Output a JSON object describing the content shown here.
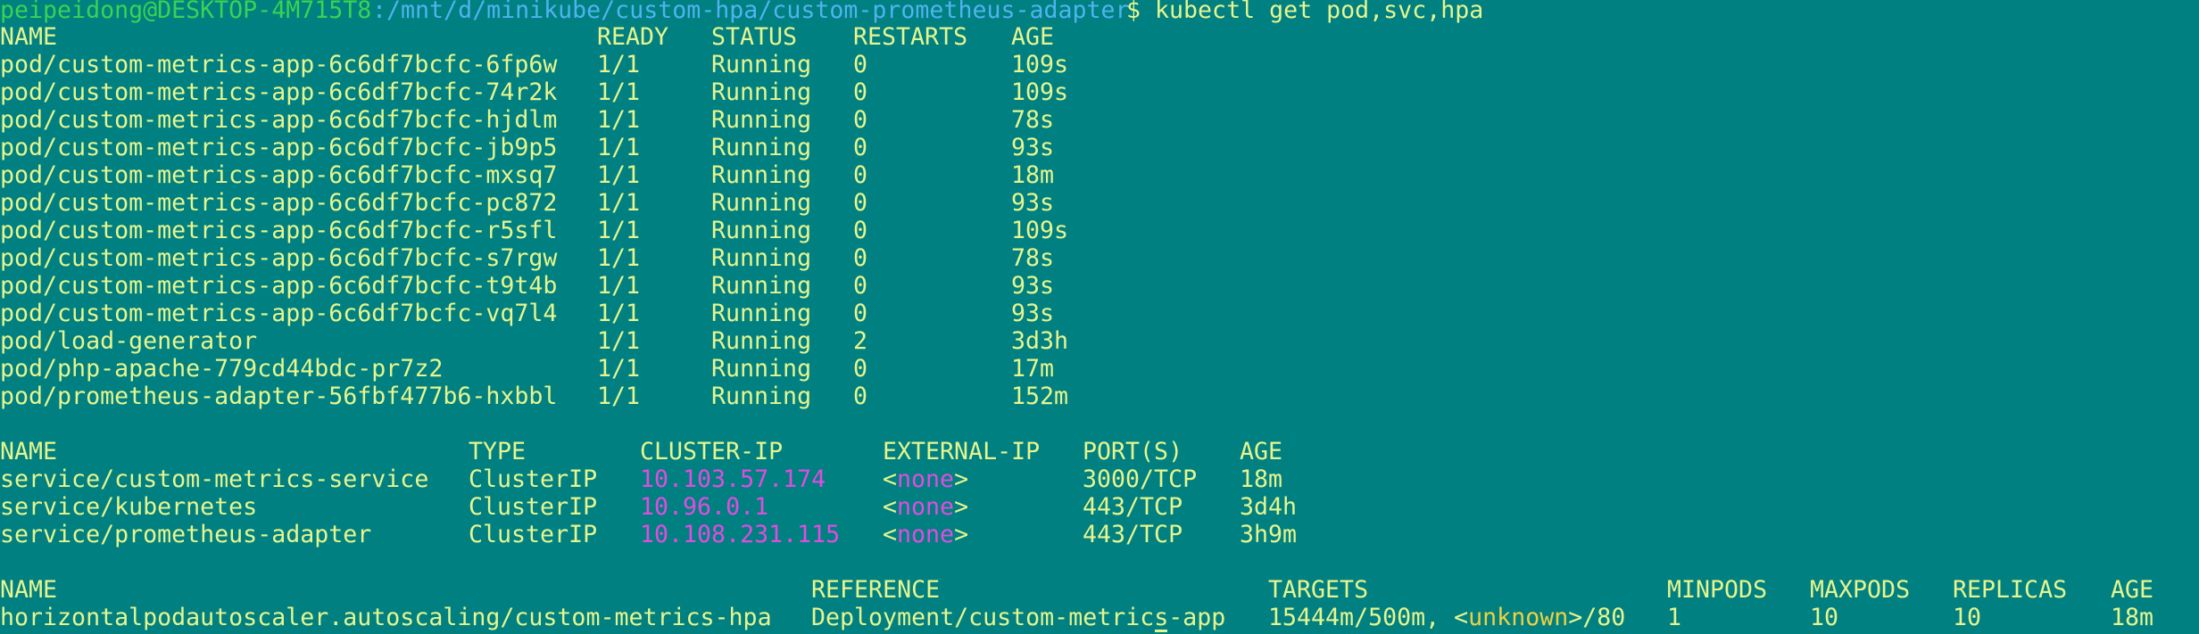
{
  "terminal": {
    "prompt": {
      "user_host": "peipeidong@DESKTOP-4M715T8",
      "path": ":/mnt/d/minikube/custom-hpa/custom-prometheus-adapter",
      "symbol": "$",
      "command": " kubectl get pod,svc,hpa"
    },
    "pods": {
      "headers": [
        "NAME",
        "READY",
        "STATUS",
        "RESTARTS",
        "AGE"
      ],
      "rows": [
        [
          "pod/custom-metrics-app-6c6df7bcfc-6fp6w",
          "1/1",
          "Running",
          "0",
          "109s"
        ],
        [
          "pod/custom-metrics-app-6c6df7bcfc-74r2k",
          "1/1",
          "Running",
          "0",
          "109s"
        ],
        [
          "pod/custom-metrics-app-6c6df7bcfc-hjdlm",
          "1/1",
          "Running",
          "0",
          "78s"
        ],
        [
          "pod/custom-metrics-app-6c6df7bcfc-jb9p5",
          "1/1",
          "Running",
          "0",
          "93s"
        ],
        [
          "pod/custom-metrics-app-6c6df7bcfc-mxsq7",
          "1/1",
          "Running",
          "0",
          "18m"
        ],
        [
          "pod/custom-metrics-app-6c6df7bcfc-pc872",
          "1/1",
          "Running",
          "0",
          "93s"
        ],
        [
          "pod/custom-metrics-app-6c6df7bcfc-r5sfl",
          "1/1",
          "Running",
          "0",
          "109s"
        ],
        [
          "pod/custom-metrics-app-6c6df7bcfc-s7rgw",
          "1/1",
          "Running",
          "0",
          "78s"
        ],
        [
          "pod/custom-metrics-app-6c6df7bcfc-t9t4b",
          "1/1",
          "Running",
          "0",
          "93s"
        ],
        [
          "pod/custom-metrics-app-6c6df7bcfc-vq7l4",
          "1/1",
          "Running",
          "0",
          "93s"
        ],
        [
          "pod/load-generator",
          "1/1",
          "Running",
          "2",
          "3d3h"
        ],
        [
          "pod/php-apache-779cd44bdc-pr7z2",
          "1/1",
          "Running",
          "0",
          "17m"
        ],
        [
          "pod/prometheus-adapter-56fbf477b6-hxbbl",
          "1/1",
          "Running",
          "0",
          "152m"
        ]
      ]
    },
    "services": {
      "headers": [
        "NAME",
        "TYPE",
        "CLUSTER-IP",
        "EXTERNAL-IP",
        "PORT(S)",
        "AGE"
      ],
      "rows": [
        [
          "service/custom-metrics-service",
          "ClusterIP",
          "10.103.57.174",
          "<none>",
          "3000/TCP",
          "18m"
        ],
        [
          "service/kubernetes",
          "ClusterIP",
          "10.96.0.1",
          "<none>",
          "443/TCP",
          "3d4h"
        ],
        [
          "service/prometheus-adapter",
          "ClusterIP",
          "10.108.231.115",
          "<none>",
          "443/TCP",
          "3h9m"
        ]
      ]
    },
    "hpa": {
      "headers": [
        "NAME",
        "REFERENCE",
        "TARGETS",
        "MINPODS",
        "MAXPODS",
        "REPLICAS",
        "AGE"
      ],
      "rows": [
        {
          "name": "horizontalpodautoscaler.autoscaling/custom-metrics-hpa",
          "reference": "Deployment/custom-metrics-app",
          "targets_prefix": "15444m/500m, <",
          "targets_unknown": "unknown",
          "targets_suffix": ">/80",
          "minpods": "1",
          "maxpods": "10",
          "replicas": "10",
          "age": "18m"
        }
      ]
    },
    "colors": {
      "background": "#008080",
      "text": "#e6f58f",
      "user_host": "#39d353",
      "path": "#4fb3f0",
      "ip_and_none": "#e04ce0",
      "unknown": "#f0d040"
    }
  }
}
